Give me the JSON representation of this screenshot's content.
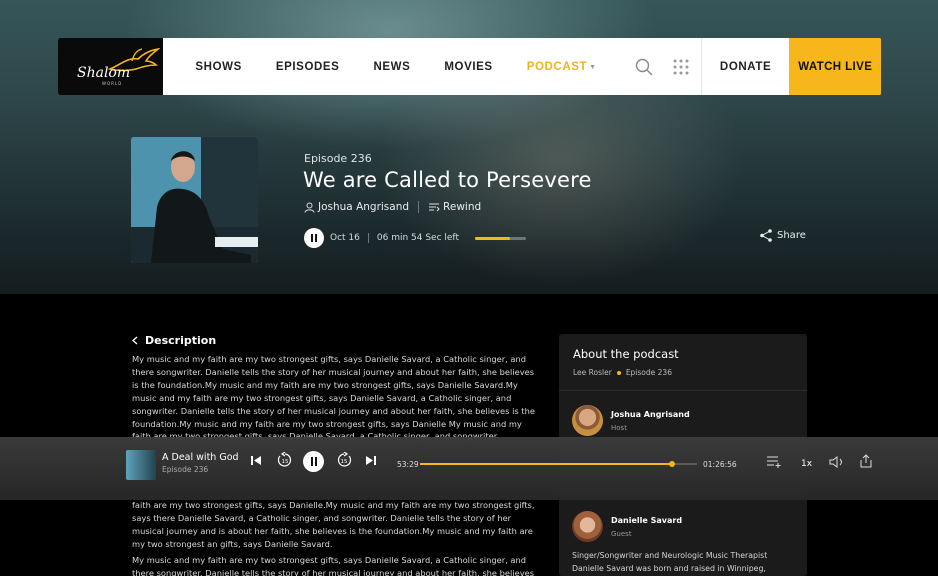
{
  "nav": {
    "logo": "Shalom",
    "logo_sub": "WORLD",
    "links": [
      "SHOWS",
      "EPISODES",
      "NEWS",
      "MOVIES"
    ],
    "active_link": "PODCAST",
    "donate": "DONATE",
    "watch_live": "WATCH LIVE"
  },
  "episode": {
    "number": "Episode 236",
    "title": "We are Called to Persevere",
    "author": "Joshua Angrisand",
    "rewind": "Rewind",
    "date": "Oct 16",
    "time_left": "06 min 54 Sec left",
    "progress": 0.68,
    "share": "Share"
  },
  "description": {
    "heading": "Description",
    "text_top": "My music and my faith are my two strongest gifts, says Danielle Savard, a Catholic singer, and there songwriter. Danielle tells the story of her musical journey and about her faith, she believes is the foundation.My music and my faith are my two strongest gifts, says Danielle Savard.My music and my faith are my two strongest gifts, says Danielle Savard, a Catholic singer, and songwriter. Danielle tells the story of her musical journey and about her faith, she believes is the foundation.My music and my faith are my two strongest gifts, says Danielle My music and my faith are my two strongest gifts, says Danielle Savard, a Catholic singer, and songwriter.",
    "text_mid": "faith are my two strongest gifts, says Danielle.My music and my faith are my two strongest gifts, says there Danielle Savard, a Catholic singer, and songwriter. Danielle tells the story of her musical journey and is about her faith, she believes is the foundation.My music and my faith are my two strongest  an gifts, says Danielle Savard.",
    "text_bottom": "My music and my faith are my two strongest gifts, says Danielle Savard, a Catholic singer, and there songwriter. Danielle tells the story of her musical journey and about her faith, she believes is the"
  },
  "about": {
    "title": "About the podcast",
    "presenter": "Lee Rosler",
    "episode": "Episode 236",
    "people": [
      {
        "name": "Joshua Angrisand",
        "role": "Host"
      },
      {
        "name": "Danielle Savard",
        "role": "Guest"
      }
    ],
    "bio": "Singer/Songwriter and Neurologic Music Therapist Danielle Savard was born and raised in Winnipeg,"
  },
  "player": {
    "title": "A Deal with God",
    "episode": "Episode 236",
    "current_time": "53:29",
    "total_time": "01:26:56",
    "progress": 0.91,
    "speed": "1x",
    "skip_back": "15",
    "skip_fwd": "15"
  },
  "colors": {
    "accent": "#f7b61b",
    "panel": "#1b1b1b",
    "player": "#3a3a3a"
  },
  "icons": [
    "search-icon",
    "grid-icon",
    "user-icon",
    "rewind-icon",
    "pause-icon",
    "share-icon",
    "chevron-left-icon",
    "skip-previous-icon",
    "replay-15-icon",
    "forward-15-icon",
    "skip-next-icon",
    "queue-icon",
    "volume-icon",
    "export-icon"
  ]
}
